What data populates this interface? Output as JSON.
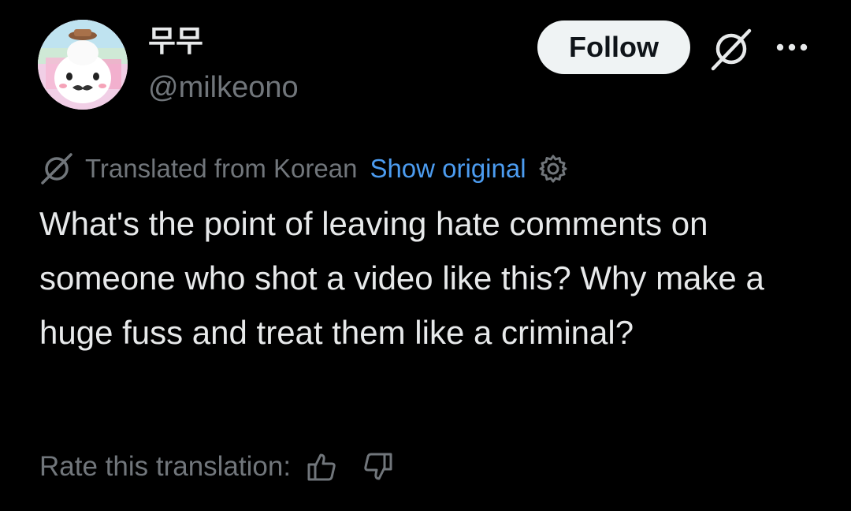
{
  "author": {
    "display_name": "무무",
    "handle": "@milkeono",
    "avatar_icon": "seal-character-avatar"
  },
  "header_actions": {
    "follow_label": "Follow",
    "grok_icon": "grok-icon",
    "more_icon": "more-options-icon"
  },
  "translation": {
    "label": "Translated from Korean",
    "show_original_label": "Show original",
    "settings_icon": "gear-icon"
  },
  "post": {
    "text": "What's the point of leaving hate comments on someone who shot a video like this? Why make a huge fuss and treat them like a criminal?"
  },
  "rating": {
    "label": "Rate this translation:",
    "thumbs_up_icon": "thumbs-up-icon",
    "thumbs_down_icon": "thumbs-down-icon"
  },
  "colors": {
    "background": "#000000",
    "primary_text": "#e7e9ea",
    "secondary_text": "#71767b",
    "link": "#4c9cf0",
    "follow_button_bg": "#eff3f4"
  }
}
